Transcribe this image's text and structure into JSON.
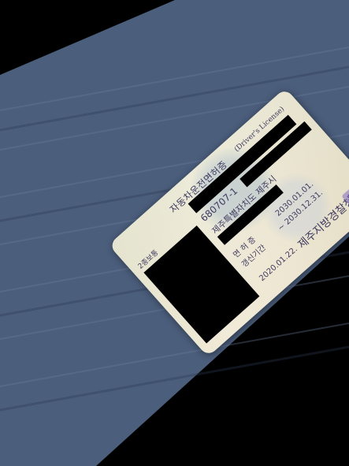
{
  "license": {
    "title": "자동차운전면허증",
    "title_en": "(Driver's License)",
    "class": "2종보통",
    "number_partial": "680707-1",
    "address": "제주특별자치도 제주시",
    "renewal_label": "면 허 증",
    "renewal_date": "2030.01.01.",
    "period_label": "갱신기간",
    "period_date": "~ 2030.12.31.",
    "issue_date": "2020.01.22.",
    "issuer": "제주지방경찰청",
    "seal_text": "청정"
  },
  "colors": {
    "card": "#efe6d2",
    "text": "#3f3a5f",
    "seal": "#826ebe",
    "table": "#4b5e7c"
  }
}
